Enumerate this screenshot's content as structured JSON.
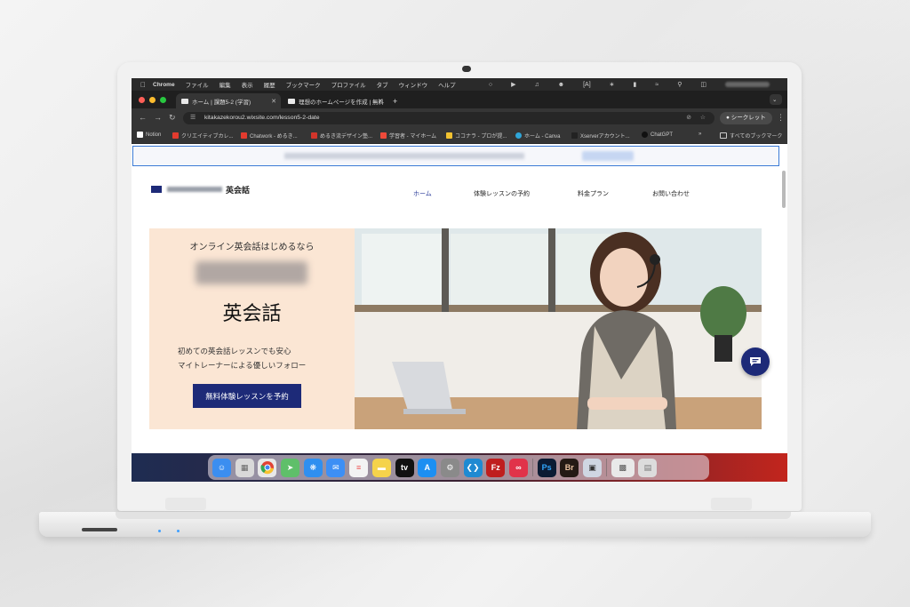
{
  "menubar": {
    "items": [
      "Chrome",
      "ファイル",
      "編集",
      "表示",
      "履歴",
      "ブックマーク",
      "プロファイル",
      "タブ",
      "ウィンドウ",
      "ヘルプ"
    ]
  },
  "tabs": [
    {
      "label": "ホーム | 課題5-2 (学習)"
    },
    {
      "label": "理想のホームページを作成 | 無料"
    }
  ],
  "address": {
    "url": "kitakazekorou2.wixsite.com/lesson5-2-date",
    "incognito_label": "シークレット"
  },
  "bookmarks": [
    {
      "label": "Notion"
    },
    {
      "label": "クリエイティブカレ..."
    },
    {
      "label": "Chatwork - めるき..."
    },
    {
      "label": "めるき流デザイン塾..."
    },
    {
      "label": "学習者 - マイホーム"
    },
    {
      "label": "ココナラ - プロが提..."
    },
    {
      "label": "ホーム - Canva"
    },
    {
      "label": "Xserverアカウント..."
    },
    {
      "label": "ChatGPT"
    }
  ],
  "bookmarks_all": "すべてのブックマーク",
  "site": {
    "logo_text": "英会話",
    "nav": [
      "ホーム",
      "体験レッスンの予約",
      "料金プラン",
      "お問い合わせ"
    ],
    "hero": {
      "subtitle": "オンライン英会話はじめるなら",
      "title": "英会話",
      "desc_line1": "初めての英会話レッスンでも安心",
      "desc_line2": "マイトレーナーによる優しいフォロー",
      "cta": "無料体験レッスンを予約"
    }
  },
  "colors": {
    "brand": "#1d2a78",
    "hero_bg": "#fbe6d4",
    "nav_active": "#2a3b9a"
  },
  "dock": {
    "icons": [
      {
        "name": "finder-icon",
        "color": "#3b8ef0"
      },
      {
        "name": "launchpad-icon",
        "color": "#d9d9d9"
      },
      {
        "name": "chrome-icon",
        "color": "#e8e8e8"
      },
      {
        "name": "maps-icon",
        "color": "#5fbf6a"
      },
      {
        "name": "safari-icon",
        "color": "#2f8ff0"
      },
      {
        "name": "mail-icon",
        "color": "#3d8ff5"
      },
      {
        "name": "reminders-icon",
        "color": "#f3f3f3"
      },
      {
        "name": "notes-icon",
        "color": "#f5d34b"
      },
      {
        "name": "apple-tv-icon",
        "color": "#111111"
      },
      {
        "name": "app-store-icon",
        "color": "#1c8ff2"
      },
      {
        "name": "system-settings-icon",
        "color": "#8a8a8a"
      },
      {
        "name": "vscode-icon",
        "color": "#1f8ad2"
      },
      {
        "name": "filezilla-icon",
        "color": "#bf1e1e"
      },
      {
        "name": "creative-cloud-icon",
        "color": "#e1334a"
      },
      {
        "name": "photoshop-icon",
        "color": "#0b1b33"
      },
      {
        "name": "bridge-icon",
        "color": "#241a14"
      },
      {
        "name": "preview-icon",
        "color": "#cfd6e2"
      },
      {
        "name": "screenshot-icon",
        "color": "#e9e9e9"
      },
      {
        "name": "trash-icon",
        "color": "#dcdcdc"
      }
    ],
    "labels": {
      "photoshop": "Ps",
      "bridge": "Br",
      "filezilla": "Fz"
    }
  }
}
